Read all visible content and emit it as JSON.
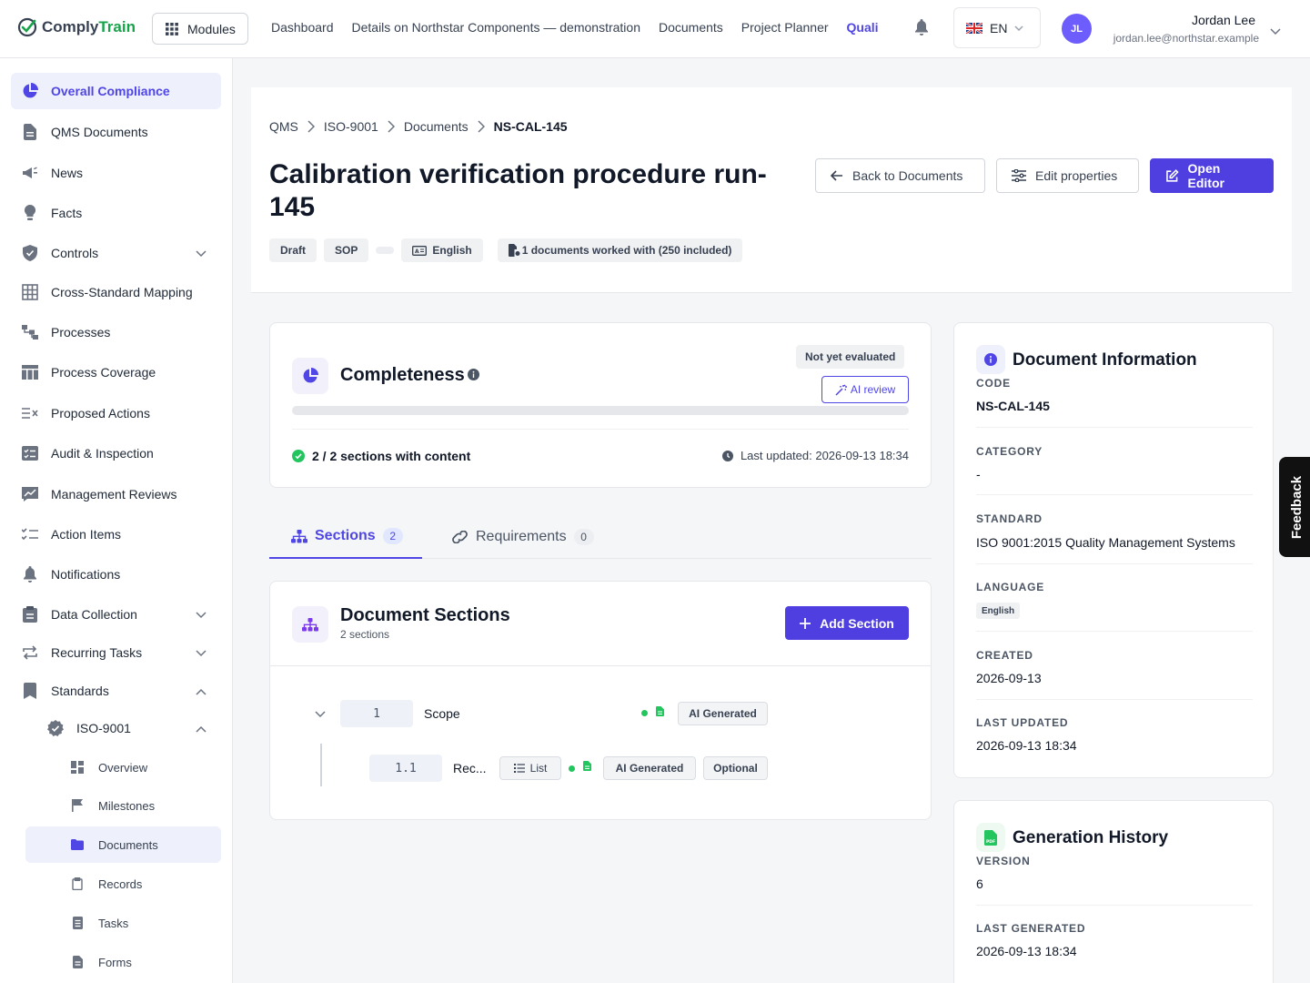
{
  "brand": {
    "part1": "Comply",
    "part2": "Train",
    "accent": "#4f46e5",
    "green": "#16a34a"
  },
  "topbar": {
    "modules_label": "Modules",
    "nav": [
      "Dashboard",
      "Details on Northstar Components — demonstration",
      "Documents",
      "Project Planner",
      "Quali"
    ],
    "lang_label": "EN",
    "user_initials": "JL",
    "user_name": "Jordan Lee",
    "user_email": "jordan.lee@northstar.example"
  },
  "sidebar": {
    "items": [
      {
        "label": "Overall Compliance",
        "icon": "pie-chart-icon"
      },
      {
        "label": "QMS Documents",
        "icon": "document-icon"
      },
      {
        "label": "News",
        "icon": "megaphone-icon"
      },
      {
        "label": "Facts",
        "icon": "lightbulb-icon"
      },
      {
        "label": "Controls",
        "icon": "shield-icon"
      },
      {
        "label": "Cross-Standard Mapping",
        "icon": "grid-icon"
      },
      {
        "label": "Processes",
        "icon": "flow-icon"
      },
      {
        "label": "Process Coverage",
        "icon": "table-icon"
      },
      {
        "label": "Proposed Actions",
        "icon": "list-x-icon"
      },
      {
        "label": "Audit & Inspection",
        "icon": "checklist-icon"
      },
      {
        "label": "Management Reviews",
        "icon": "chart-board-icon"
      },
      {
        "label": "Action Items",
        "icon": "list-check-icon"
      },
      {
        "label": "Notifications",
        "icon": "bell-icon"
      },
      {
        "label": "Data Collection",
        "icon": "clipboard-icon"
      },
      {
        "label": "Recurring Tasks",
        "icon": "repeat-icon"
      },
      {
        "label": "Standards",
        "icon": "bookmark-icon"
      }
    ],
    "standard": "ISO-9001",
    "sub_items": [
      "Overview",
      "Milestones",
      "Documents",
      "Records",
      "Tasks",
      "Forms"
    ]
  },
  "header": {
    "breadcrumb": [
      "QMS",
      "ISO-9001",
      "Documents",
      "NS-CAL-145"
    ],
    "title": "Calibration verification procedure run-145",
    "back_label": "Back to Documents",
    "edit_label": "Edit properties",
    "open_label": "Open Editor",
    "badges": {
      "status": "Draft",
      "type": "SOP",
      "language": "English",
      "docs": "1 documents worked with (250 included)"
    }
  },
  "completeness": {
    "title": "Completeness",
    "status": "Not yet evaluated",
    "ai_review": "AI review",
    "progress_fraction": 0,
    "sections_text": "2 / 2 sections with content",
    "last_updated": "Last updated: 2026-09-13 18:34"
  },
  "tabs": [
    {
      "label": "Sections",
      "count": "2"
    },
    {
      "label": "Requirements",
      "count": "0"
    }
  ],
  "sections": {
    "title": "Document Sections",
    "subtitle": "2 sections",
    "add_label": "Add Section",
    "rows": [
      {
        "num": "1",
        "label": "Scope",
        "chips": [
          "AI Generated"
        ]
      },
      {
        "num": "1.1",
        "label": "Rec...",
        "type": "List",
        "chips": [
          "AI Generated",
          "Optional"
        ]
      }
    ]
  },
  "info": {
    "title": "Document Information",
    "fields": {
      "code_label": "CODE",
      "code": "NS-CAL-145",
      "category_label": "CATEGORY",
      "category": "-",
      "standard_label": "STANDARD",
      "standard": "ISO 9001:2015 Quality Management Systems",
      "language_label": "LANGUAGE",
      "language": "English",
      "created_label": "CREATED",
      "created": "2026-09-13",
      "updated_label": "LAST UPDATED",
      "updated": "2026-09-13 18:34"
    }
  },
  "history": {
    "title": "Generation History",
    "version_label": "VERSION",
    "version": "6",
    "generated_label": "LAST GENERATED",
    "generated": "2026-09-13 18:34"
  },
  "feedback_label": "Feedback"
}
